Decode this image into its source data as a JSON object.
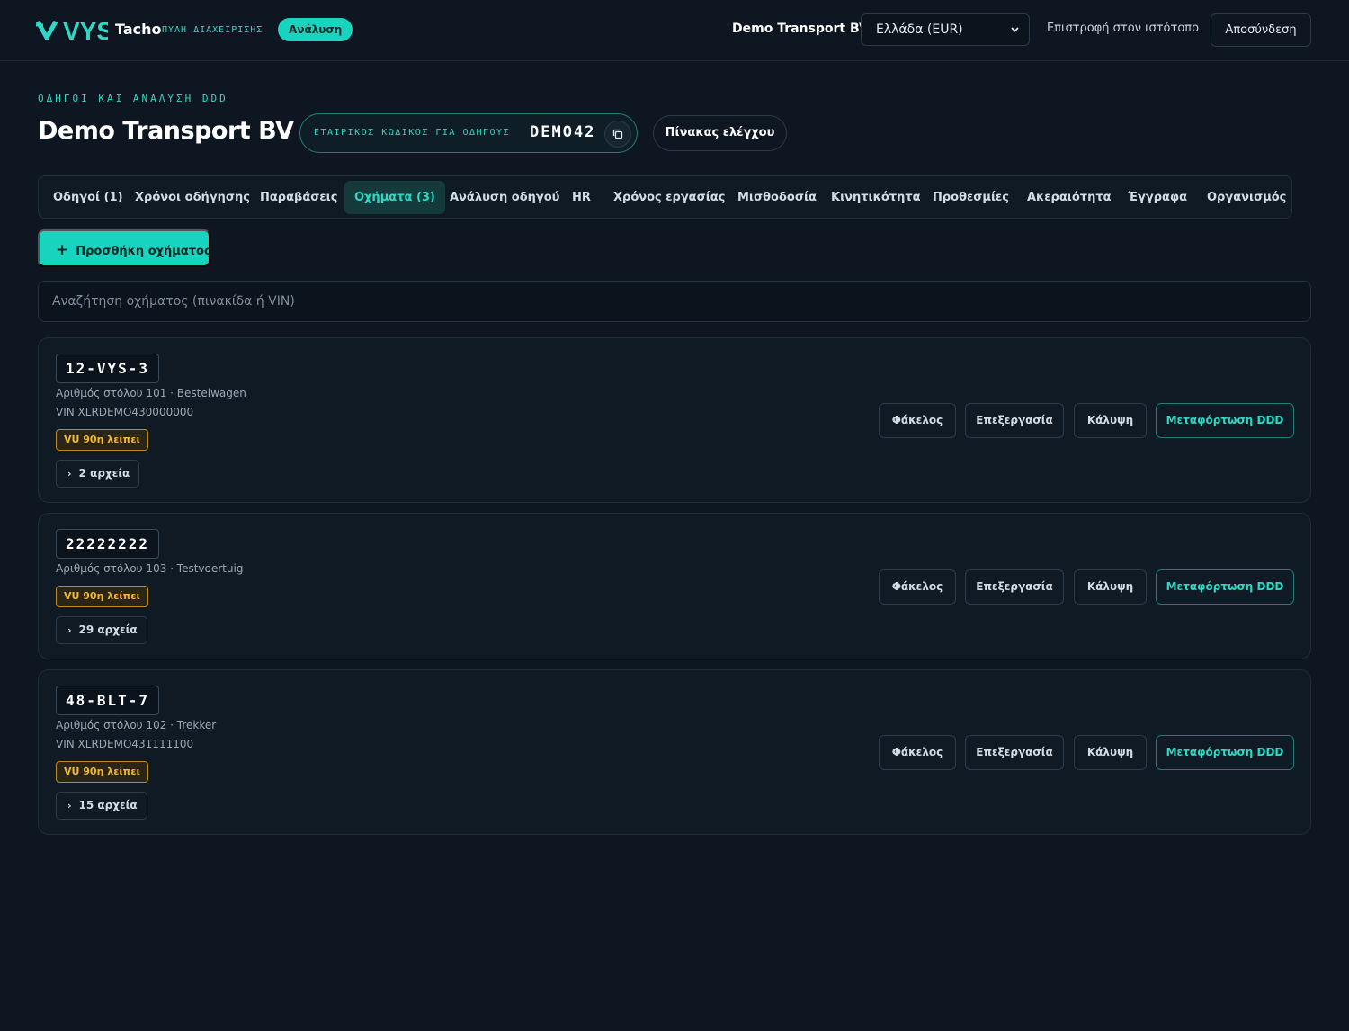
{
  "brand": {
    "logo_text": "VYS",
    "product": "Tacho",
    "subtitle": "ΠΥΛΗ ΔΙΑΧΕΙΡΙΣΗΣ",
    "mode_badge": "Ανάλυση",
    "accent_color": "#18d4bf"
  },
  "topbar": {
    "company": "Demo Transport BV",
    "country_select": "Ελλάδα (EUR)",
    "back_link": "Επιστροφή στον ιστότοπο",
    "logout": "Αποσύνδεση"
  },
  "header": {
    "eyebrow": "ΟΔΗΓΟΙ ΚΑΙ ΑΝΑΛΥΣΗ DDD",
    "title": "Demo Transport BV",
    "code_label": "ΕΤΑΙΡΙΚΟΣ ΚΩΔΙΚΟΣ ΓΙΑ ΟΔΗΓΟΥΣ",
    "code_value": "DEMO42",
    "dashboard_button": "Πίνακας ελέγχου"
  },
  "tabs": [
    {
      "label": "Οδηγοί (1)"
    },
    {
      "label": "Χρόνοι οδήγησης"
    },
    {
      "label": "Παραβάσεις"
    },
    {
      "label": "Οχήματα (3)",
      "active": true
    },
    {
      "label": "Ανάλυση οδηγού"
    },
    {
      "label": "HR"
    },
    {
      "label": "Χρόνος εργασίας"
    },
    {
      "label": "Μισθοδοσία"
    },
    {
      "label": "Κινητικότητα"
    },
    {
      "label": "Προθεσμίες"
    },
    {
      "label": "Ακεραιότητα"
    },
    {
      "label": "Έγγραφα"
    },
    {
      "label": "Οργανισμός"
    }
  ],
  "add_vehicle_button": "Προσθήκη οχήματος",
  "search": {
    "placeholder": "Αναζήτηση οχήματος (πινακίδα ή VIN)",
    "value": ""
  },
  "vehicle_actions": {
    "folder": "Φάκελος",
    "edit": "Επεξεργασία",
    "coverage": "Κάλυψη",
    "upload": "Μεταφόρτωση DDD"
  },
  "vehicles": [
    {
      "plate": "12-VYS-3",
      "fleet_info": "Αριθμός στόλου 101 · Bestelwagen",
      "vin": "VIN XLRDEMO430000000",
      "vu_badge": "VU 90η λείπει",
      "files": "2 αρχεία"
    },
    {
      "plate": "22222222",
      "fleet_info": "Αριθμός στόλου 103 · Testvoertuig",
      "vu_badge": "VU 90η λείπει",
      "files": "29 αρχεία"
    },
    {
      "plate": "48-BLT-7",
      "fleet_info": "Αριθμός στόλου 102 · Trekker",
      "vin": "VIN XLRDEMO431111100",
      "vu_badge": "VU 90η λείπει",
      "files": "15 αρχεία"
    }
  ]
}
